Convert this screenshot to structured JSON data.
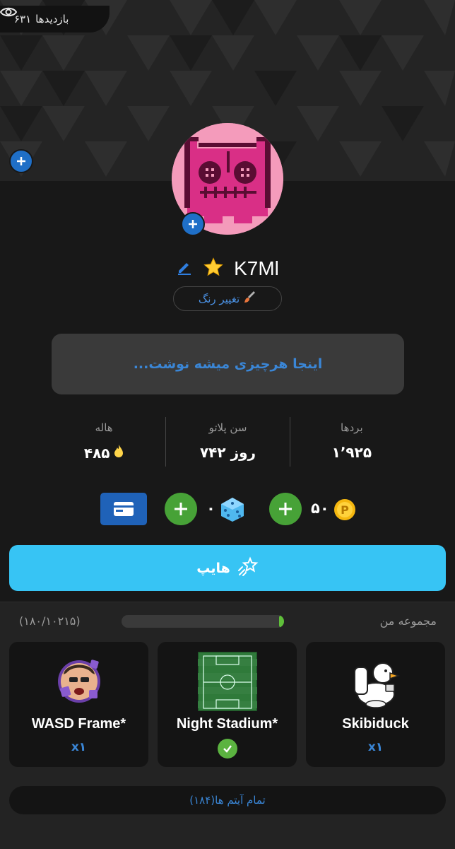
{
  "profile": {
    "views_count": "۶۳۱",
    "views_label": "بازدیدها",
    "username": "K7Ml",
    "change_color_label": "تغییر رنگ",
    "bio_placeholder": "اینجا هرچیزی میشه نوشت..."
  },
  "stats": [
    {
      "label": "بردها",
      "value": "۱٬۹۲۵"
    },
    {
      "label": "سن پلاتو",
      "value": "۷۴۲ روز"
    },
    {
      "label": "هاله",
      "value": "۴۸۵"
    }
  ],
  "currencies": {
    "coins_value": "۵۰",
    "dice_value": "۰"
  },
  "hype_label": "هایپ",
  "collection": {
    "title": "مجموعه من",
    "count": "(۱۸۰/۱۰۲۱۵)",
    "progress_fraction": 0.018,
    "items": [
      {
        "name": "Skibiduck",
        "qty": "x۱",
        "owned_check": false
      },
      {
        "name": "Night Stadium*",
        "qty": "",
        "owned_check": true
      },
      {
        "name": "WASD Frame*",
        "qty": "x۱",
        "owned_check": false
      }
    ],
    "all_items_label": "تمام آیتم ها(۱۸۴)"
  },
  "colors": {
    "accent_blue": "#1f6fc7",
    "hype": "#37c4f4",
    "green": "#47a237"
  }
}
